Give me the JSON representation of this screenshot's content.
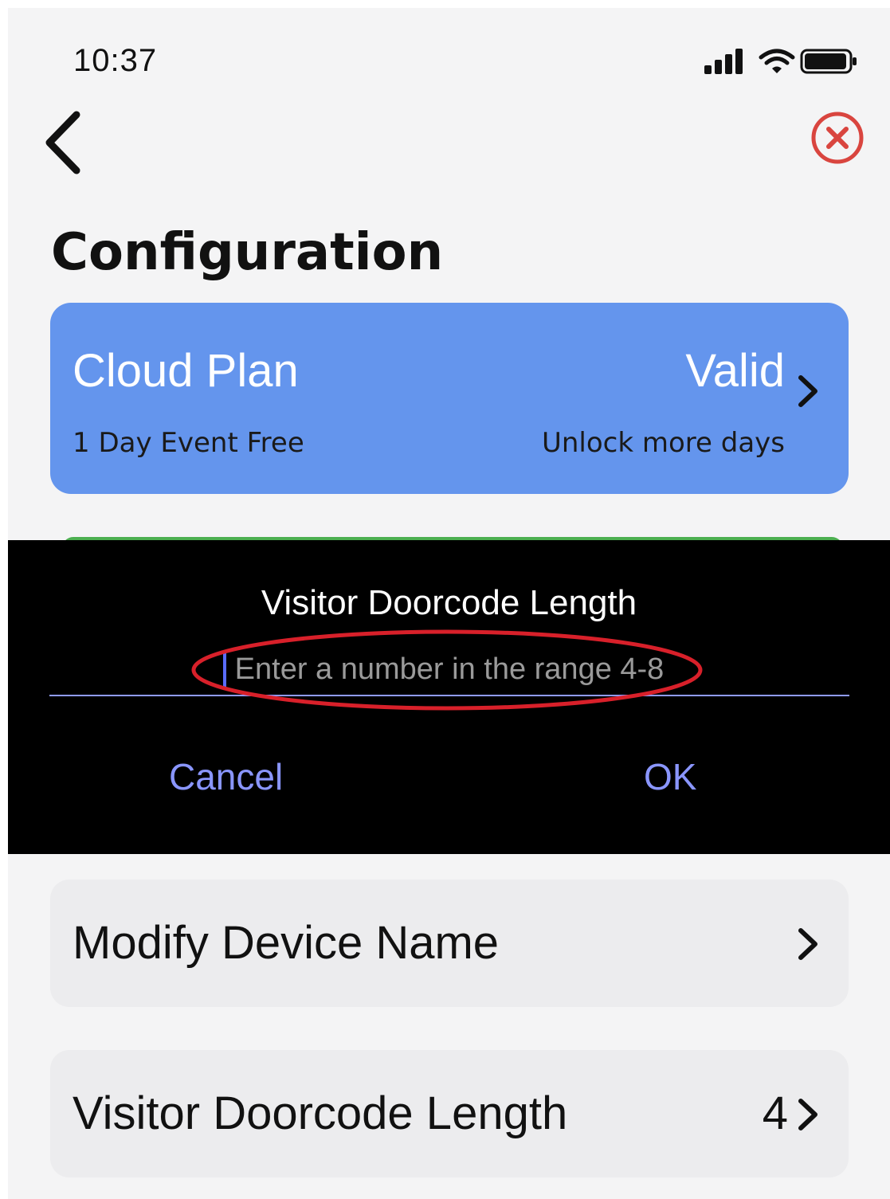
{
  "status_bar": {
    "time": "10:37",
    "icons": [
      "cellular-signal-icon",
      "wifi-icon",
      "battery-icon"
    ]
  },
  "nav": {
    "back_icon": "chevron-left-icon",
    "close_icon": "close-circle-icon",
    "close_color": "#d9453f"
  },
  "page": {
    "title": "Configuration"
  },
  "cloud_plan": {
    "name": "Cloud Plan",
    "status": "Valid",
    "subtitle": "1 Day Event Free",
    "link": "Unlock more days",
    "color": "#6495ed"
  },
  "dialog": {
    "title": "Visitor Doorcode Length",
    "input_value": "",
    "input_placeholder": "Enter a number in the range 4-8",
    "cancel_label": "Cancel",
    "ok_label": "OK",
    "button_color": "#8a96ff",
    "annotation_color": "#d8202a"
  },
  "settings": [
    {
      "label": "Modify Device Name",
      "value": ""
    },
    {
      "label": "Visitor Doorcode Length",
      "value": "4"
    }
  ]
}
